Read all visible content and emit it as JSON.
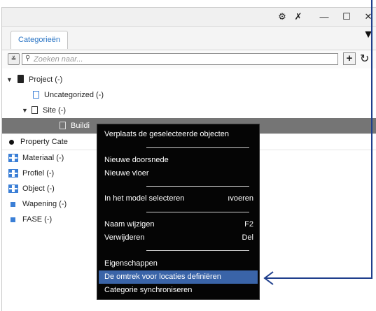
{
  "window": {
    "tab_label": "Categorieën",
    "titlebar_buttons": [
      "gear-icon",
      "pin-icon",
      "minimize-icon",
      "maximize-icon",
      "close-icon"
    ],
    "tab_dropdown_glyph": "▼"
  },
  "toolbar": {
    "search_placeholder": "Zoeken naar...",
    "add_label": "+",
    "refresh_label": "↻",
    "filter_label": "≚"
  },
  "tree": {
    "rows": [
      {
        "label": "Project (-)"
      },
      {
        "label": "Uncategorized (-)"
      },
      {
        "label": "Site (-)"
      },
      {
        "label": "Buildi"
      },
      {
        "label": "Property Cate"
      },
      {
        "label": "Materiaal (-)"
      },
      {
        "label": "Profiel (-)"
      },
      {
        "label": "Object (-)"
      },
      {
        "label": "Wapening (-)"
      },
      {
        "label": "FASE (-)"
      }
    ]
  },
  "context_menu": {
    "items": [
      {
        "label": "Verplaats de geselecteerde objecten",
        "shortcut": ""
      },
      {
        "label": "Nieuwe doorsnede",
        "shortcut": ""
      },
      {
        "label": "Nieuwe vloer",
        "shortcut": ""
      },
      {
        "label": "In het model selecteren",
        "shortcut": "ıvoeren"
      },
      {
        "label": "Naam wijzigen",
        "shortcut": "F2"
      },
      {
        "label": "Verwijderen",
        "shortcut": "Del"
      },
      {
        "label": "Eigenschappen",
        "shortcut": ""
      },
      {
        "label": "De omtrek voor locaties definiëren",
        "shortcut": ""
      },
      {
        "label": "Categorie synchroniseren",
        "shortcut": ""
      }
    ]
  },
  "colors": {
    "accent": "#3b7fd6",
    "selection": "#757575",
    "menu_highlight": "#3a64a8",
    "callout": "#1f3f8c"
  }
}
